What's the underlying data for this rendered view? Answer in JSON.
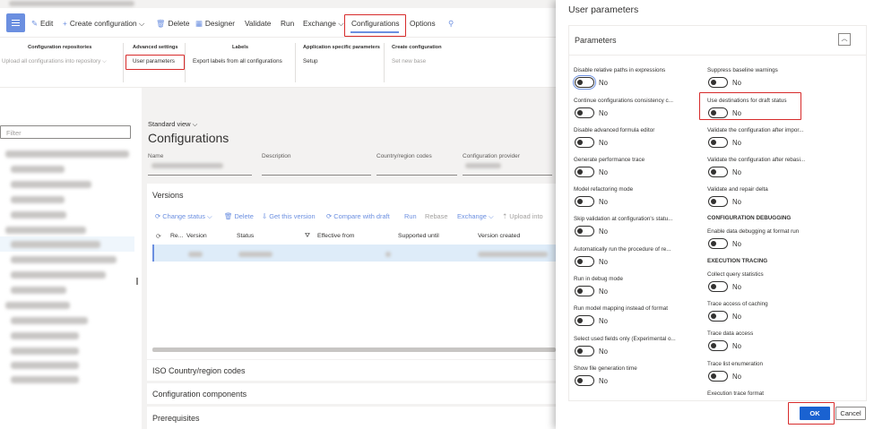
{
  "cmdbar": {
    "edit": "Edit",
    "create_configuration": "Create configuration",
    "delete": "Delete",
    "designer": "Designer",
    "validate": "Validate",
    "run": "Run",
    "exchange": "Exchange",
    "configurations": "Configurations",
    "options": "Options"
  },
  "ribbon": {
    "groups": [
      {
        "header": "Configuration repositories",
        "item": "Upload all configurations into repository"
      },
      {
        "header": "Advanced settings",
        "item": "User parameters"
      },
      {
        "header": "Labels",
        "item": "Export labels from all configurations"
      },
      {
        "header": "Application specific parameters",
        "item": "Setup"
      },
      {
        "header": "Create configuration",
        "item": "Set new base"
      }
    ]
  },
  "left": {
    "filter_placeholder": "Filter"
  },
  "main": {
    "standard_view": "Standard view",
    "title": "Configurations",
    "fields": [
      "Name",
      "Description",
      "Country/region codes",
      "Configuration provider"
    ],
    "versions": {
      "title": "Versions",
      "commands": [
        "Change status",
        "Delete",
        "Get this version",
        "Compare with draft",
        "Run",
        "Rebase",
        "Exchange",
        "Upload into"
      ],
      "columns": [
        "Re...",
        "Version",
        "Status",
        "Effective from",
        "Supported until",
        "Version created"
      ]
    },
    "sections": [
      "ISO Country/region codes",
      "Configuration components",
      "Prerequisites"
    ]
  },
  "dialog": {
    "title": "User parameters",
    "section": "Parameters",
    "toggle_off_text": "No",
    "left_params": [
      "Disable relative paths in expressions",
      "Continue configurations consistency c...",
      "Disable advanced formula editor",
      "Generate performance trace",
      "Model refactoring mode",
      "Skip validation at configuration's statu...",
      "Automatically run the procedure of re...",
      "Run in debug mode",
      "Run model mapping instead of format",
      "Select used fields only (Experimental o...",
      "Show file generation time"
    ],
    "right_params": [
      "Suppress baseline warnings",
      "Use destinations for draft status",
      "Validate the configuration after impor...",
      "Validate the configuration after rebasi...",
      "Validate and repair delta"
    ],
    "debug_header": "CONFIGURATION DEBUGGING",
    "debug_params": [
      "Enable data debugging at format run"
    ],
    "trace_header": "EXECUTION TRACING",
    "trace_params": [
      "Collect query statistics",
      "Trace access of caching",
      "Trace data access",
      "Trace list enumeration"
    ],
    "trace_format_label": "Execution trace format",
    "ok": "OK",
    "cancel": "Cancel"
  }
}
